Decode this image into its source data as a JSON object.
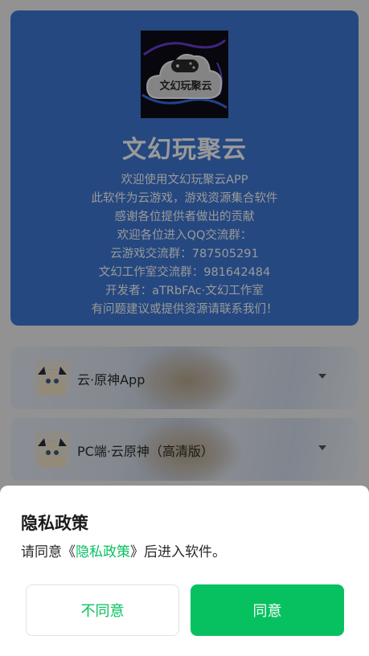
{
  "hero": {
    "logo_text": "文幻玩聚云",
    "app_name": "文幻玩聚云",
    "lines": [
      "欢迎使用文幻玩聚云APP",
      "此软件为云游戏，游戏资源集合软件",
      "感谢各位提供者做出的贡献",
      "欢迎各位进入QQ交流群：",
      "云游戏交流群：787505291",
      "文幻工作室交流群：981642484",
      "开发者：aTRbFAc·文幻工作室",
      "有问题建议或提供资源请联系我们！"
    ],
    "bg_color": "#3f78d6"
  },
  "games": [
    {
      "label": "云·原神App",
      "icon": "genshin-avatar-icon"
    },
    {
      "label": "PC端·云原神（高清版）",
      "icon": "genshin-avatar-icon"
    }
  ],
  "dialog": {
    "title": "隐私政策",
    "msg_prefix": "请同意《",
    "msg_link": "隐私政策",
    "msg_suffix": "》后进入软件。",
    "disagree_label": "不同意",
    "agree_label": "同意",
    "accent_color": "#07c160"
  }
}
